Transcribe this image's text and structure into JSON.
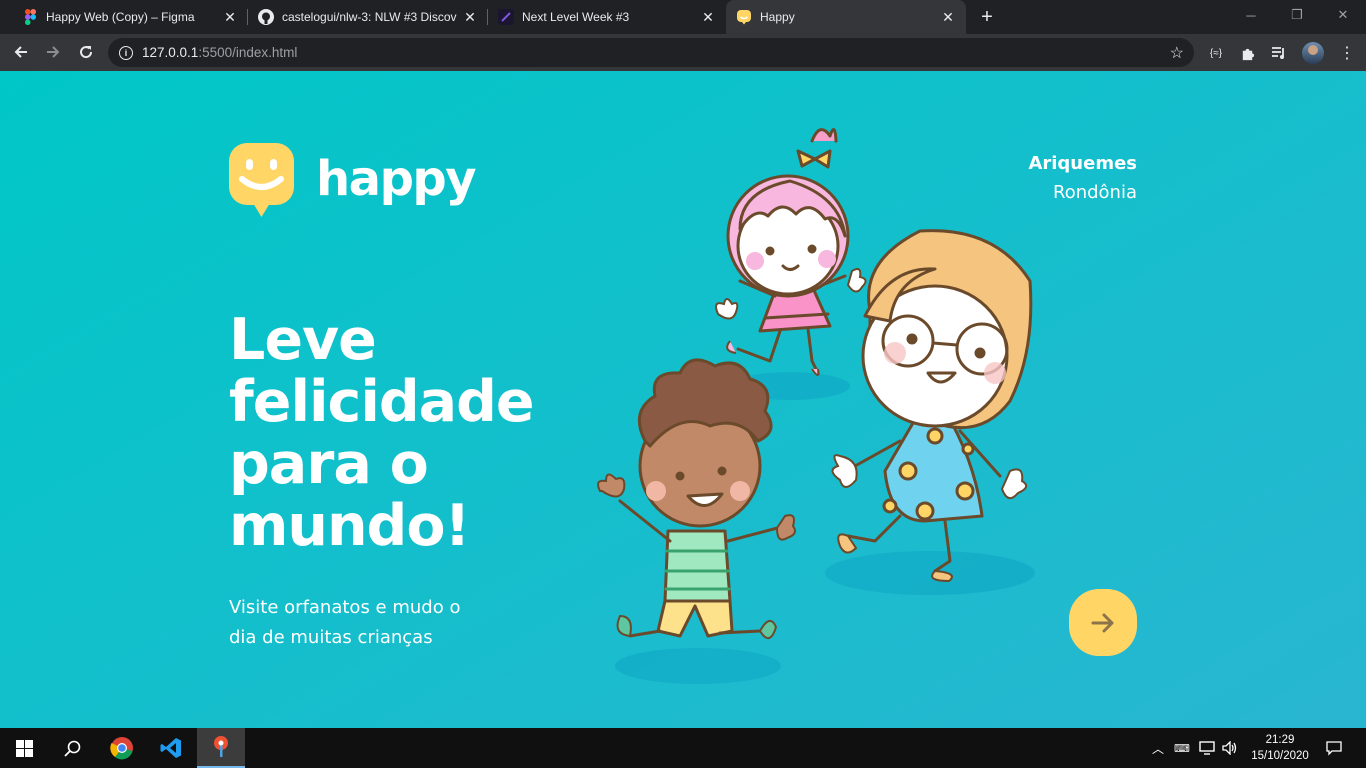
{
  "browser": {
    "tabs": [
      {
        "title": "Happy Web (Copy) – Figma",
        "icon": "figma-icon",
        "active": false
      },
      {
        "title": "castelogui/nlw-3: NLW #3 Discov",
        "icon": "github-icon",
        "active": false
      },
      {
        "title": "Next Level Week #3",
        "icon": "rocketseat-icon",
        "active": false
      },
      {
        "title": "Happy",
        "icon": "happy-icon",
        "active": true
      }
    ],
    "new_tab": "+",
    "address": {
      "host": "127.0.0.1",
      "rest": ":5500/index.html"
    },
    "window_controls": [
      "minimize",
      "restore",
      "close"
    ]
  },
  "page": {
    "brand": "happy",
    "location": {
      "city": "Ariquemes",
      "state": "Rondônia"
    },
    "headline": [
      "Leve",
      "felicidade",
      "para o",
      "mundo!"
    ],
    "subtitle": "Visite orfanatos e mudo o dia de muitas crianças",
    "enter_button_icon": "arrow-right-icon",
    "colors": {
      "gradient_start": "#00C7C7",
      "gradient_end": "#29B6D1",
      "accent": "#FFD666",
      "arrow": "#8D734B"
    }
  },
  "taskbar": {
    "apps": [
      "start-icon",
      "search-icon",
      "chrome-icon",
      "vscode-icon",
      "git-icon"
    ],
    "time": "21:29",
    "date": "15/10/2020"
  }
}
